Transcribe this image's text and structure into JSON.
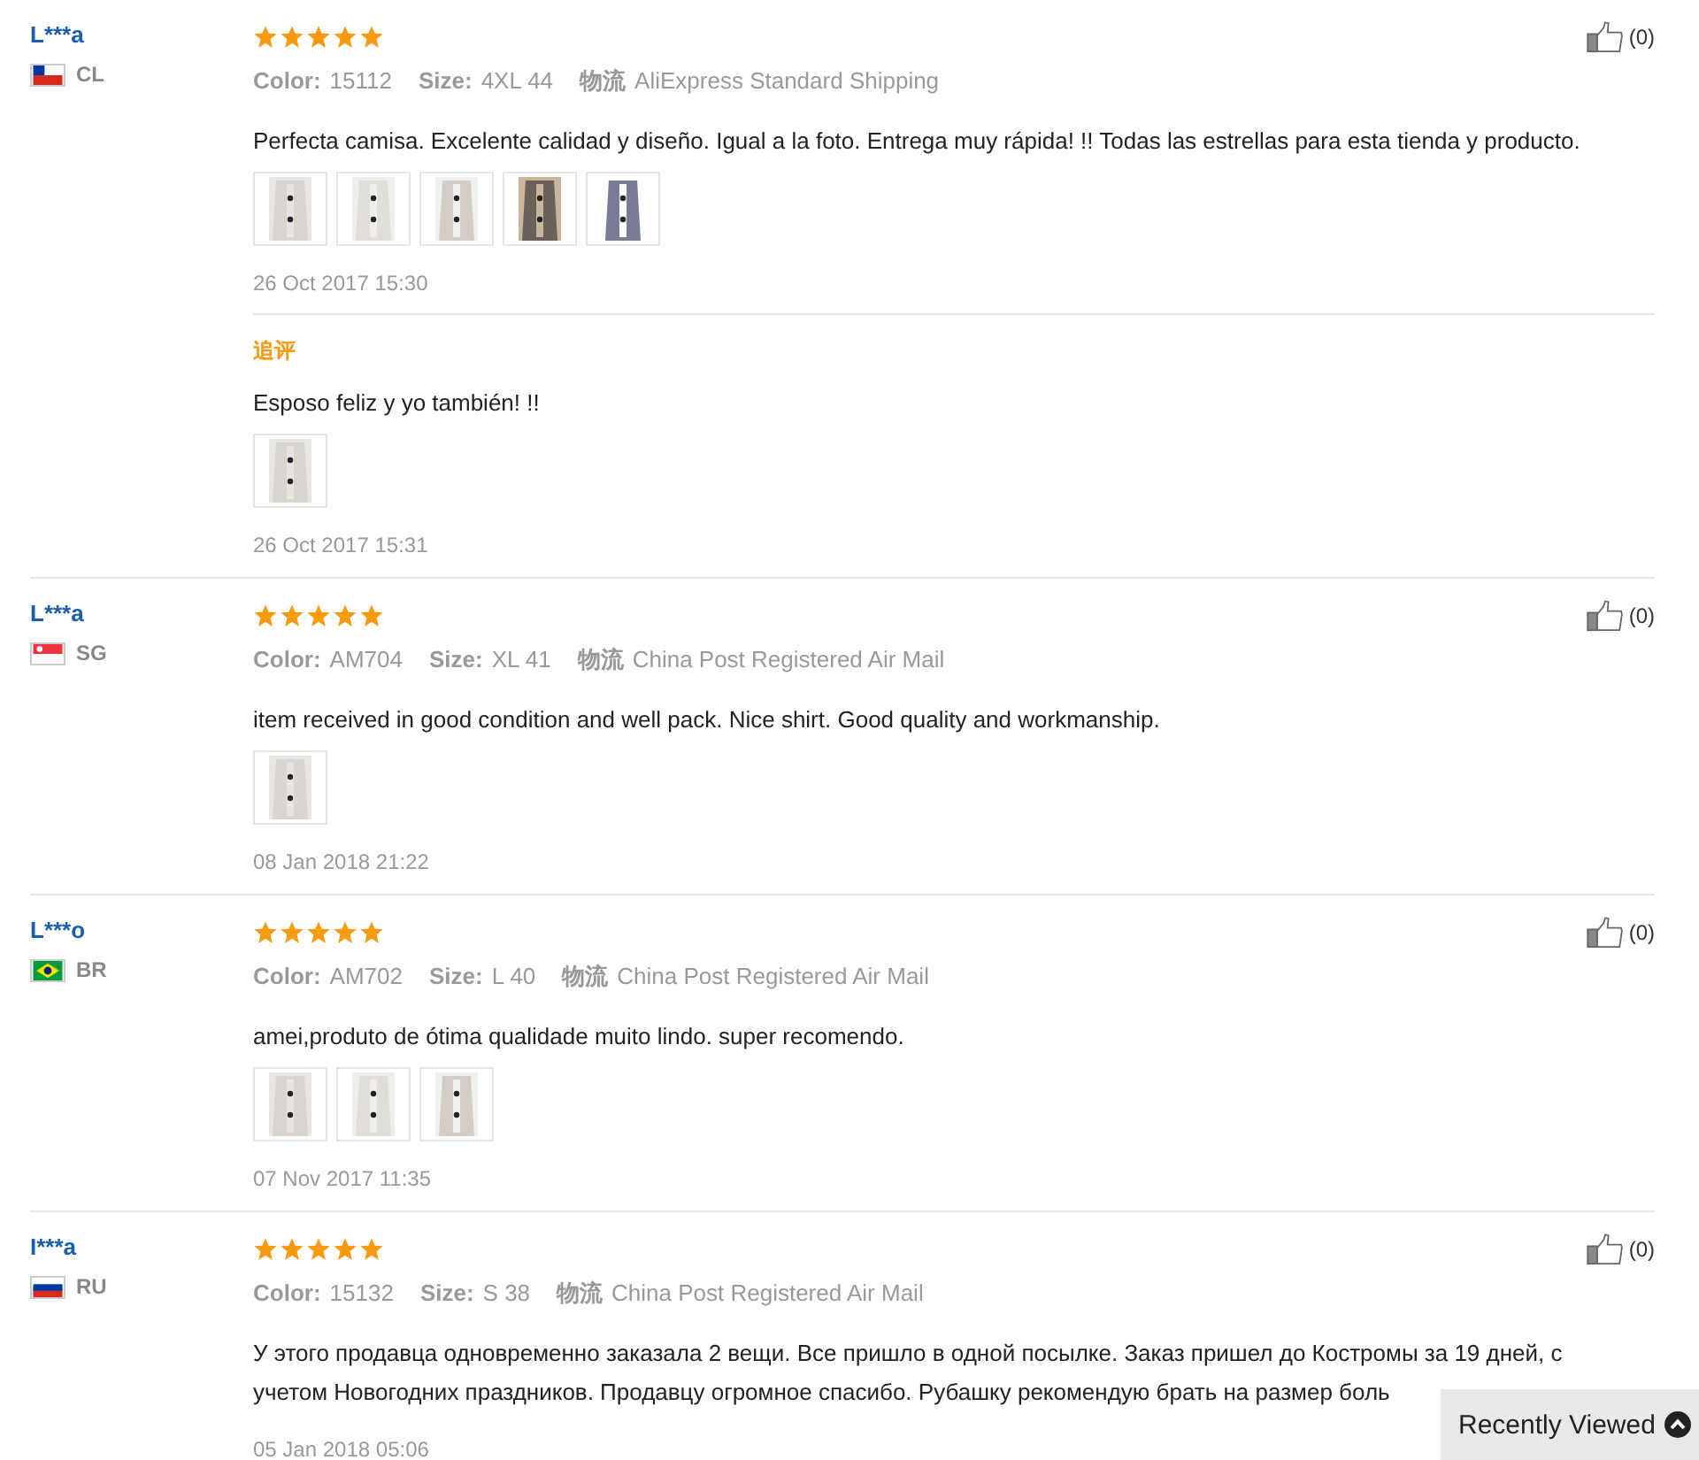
{
  "reviews": [
    {
      "name": "L***a",
      "flag": {
        "kind": "cl"
      },
      "country": "CL",
      "stars": 5,
      "color_label": "Color:",
      "color_value": "15112",
      "size_label": "Size:",
      "size": "4XL 44",
      "shipping_label": "物流",
      "shipping": "AliExpress Standard Shipping",
      "likes": "(0)",
      "text": "Perfecta camisa. Excelente calidad y diseño. Igual a la foto. Entrega muy rápida! !! Todas las estrellas para esta tienda y producto.",
      "photos": [
        {
          "kind": "picture"
        },
        {
          "kind": "picture"
        },
        {
          "kind": "picture"
        },
        {
          "kind": "picture"
        },
        {
          "kind": "picture"
        }
      ],
      "date": "26 Oct 2017 15:30",
      "followup": {
        "label": "追评",
        "text": "Esposo feliz y yo también! !!",
        "photos": [
          {
            "kind": "picture"
          }
        ],
        "date": "26 Oct 2017 15:31"
      }
    },
    {
      "name": "L***a",
      "flag": {
        "kind": "sg"
      },
      "country": "SG",
      "stars": 5,
      "color_label": "Color:",
      "color_value": "AM704",
      "size_label": "Size:",
      "size": "XL 41",
      "shipping_label": "物流",
      "shipping": "China Post Registered Air Mail",
      "likes": "(0)",
      "text": "item received in good condition and well pack. Nice shirt. Good quality and workmanship.",
      "photos": [
        {
          "kind": "picture"
        }
      ],
      "date": "08 Jan 2018 21:22"
    },
    {
      "name": "L***o",
      "flag": {
        "kind": "br"
      },
      "country": "BR",
      "stars": 5,
      "color_label": "Color:",
      "color_value": "AM702",
      "size_label": "Size:",
      "size": "L 40",
      "shipping_label": "物流",
      "shipping": "China Post Registered Air Mail",
      "likes": "(0)",
      "text": "amei,produto de ótima qualidade muito lindo. super recomendo.",
      "photos": [
        {
          "kind": "picture"
        },
        {
          "kind": "picture"
        },
        {
          "kind": "picture"
        }
      ],
      "date": "07 Nov 2017 11:35"
    },
    {
      "name": "I***a",
      "flag": {
        "kind": "ru"
      },
      "country": "RU",
      "stars": 5,
      "color_label": "Color:",
      "color_value": "15132",
      "size_label": "Size:",
      "size": "S 38",
      "shipping_label": "物流",
      "shipping": "China Post Registered Air Mail",
      "likes": "(0)",
      "text": "У этого продавца одновременно заказала 2 вещи. Все пришло в одной посылке. Заказ пришел до Костромы за 19 дней, с учетом Новогодних праздников. Продавцу огромное спасибо. Рубашку рекомендую брать на размер боль",
      "date": "05 Jan 2018 05:06"
    }
  ],
  "recently_viewed": {
    "label": "Recently Viewed"
  }
}
